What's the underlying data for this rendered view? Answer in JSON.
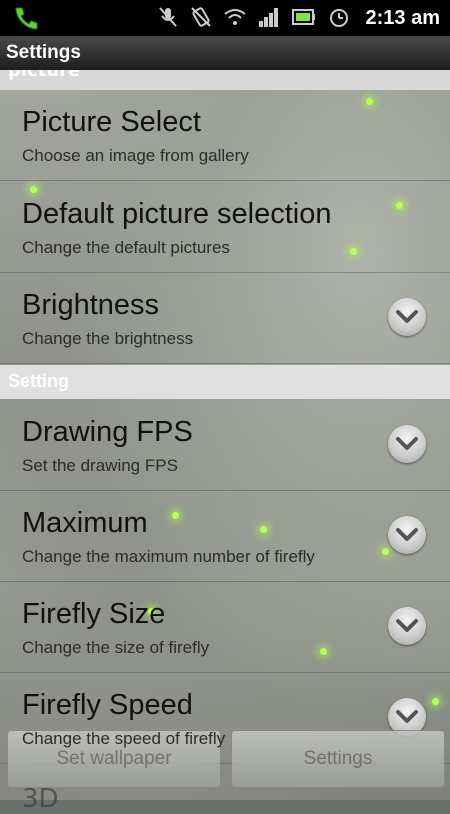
{
  "status_bar": {
    "time": "2:13 am",
    "icons": [
      "phone-icon",
      "mute-icon",
      "vibrate-icon",
      "wifi-icon",
      "signal-icon",
      "battery-icon",
      "alarm-icon"
    ]
  },
  "title_bar": {
    "title": "Settings"
  },
  "partial_section_header": "picture",
  "items_top": [
    {
      "title": "Picture Select",
      "subtitle": "Choose an image from gallery",
      "chevron": false
    },
    {
      "title": "Default picture selection",
      "subtitle": "Change the default pictures",
      "chevron": false
    },
    {
      "title": "Brightness",
      "subtitle": "Change the brightness",
      "chevron": true
    }
  ],
  "section_header": "Setting",
  "items_bottom": [
    {
      "title": "Drawing FPS",
      "subtitle": "Set the drawing FPS",
      "chevron": true
    },
    {
      "title": "Maximum",
      "subtitle": "Change the maximum number of firefly",
      "chevron": true
    },
    {
      "title": "Firefly Size",
      "subtitle": "Change the size of firefly",
      "chevron": true
    },
    {
      "title": "Firefly Speed",
      "subtitle": "Change the speed of firefly",
      "chevron": true
    }
  ],
  "bottom_buttons": {
    "set_wallpaper": "Set wallpaper",
    "settings": "Settings"
  },
  "peek_item": "3D",
  "colors": {
    "firefly": "#b8ff55",
    "status_bar": "#000000"
  }
}
